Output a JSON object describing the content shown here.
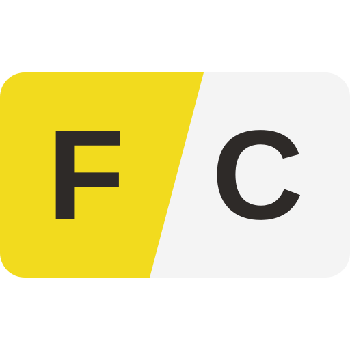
{
  "logo": {
    "left_letter": "F",
    "right_letter": "C",
    "colors": {
      "yellow": "#F2DB1E",
      "light_gray": "#F4F4F4",
      "letter": "#2E2A28",
      "background": "#FFFFFF"
    }
  }
}
